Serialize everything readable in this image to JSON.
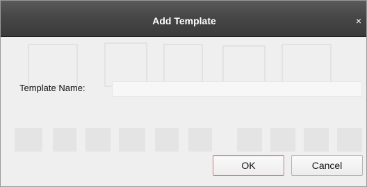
{
  "dialog": {
    "title": "Add Template",
    "close_glyph": "×",
    "close_icon": "close-icon"
  },
  "form": {
    "template_name_label": "Template Name:",
    "template_name_value": "",
    "template_name_placeholder": ""
  },
  "buttons": {
    "ok_label": "OK",
    "cancel_label": "Cancel"
  },
  "colors": {
    "titlebar": "#474747",
    "title_text": "#ffffff",
    "ok_border": "#c98585"
  }
}
